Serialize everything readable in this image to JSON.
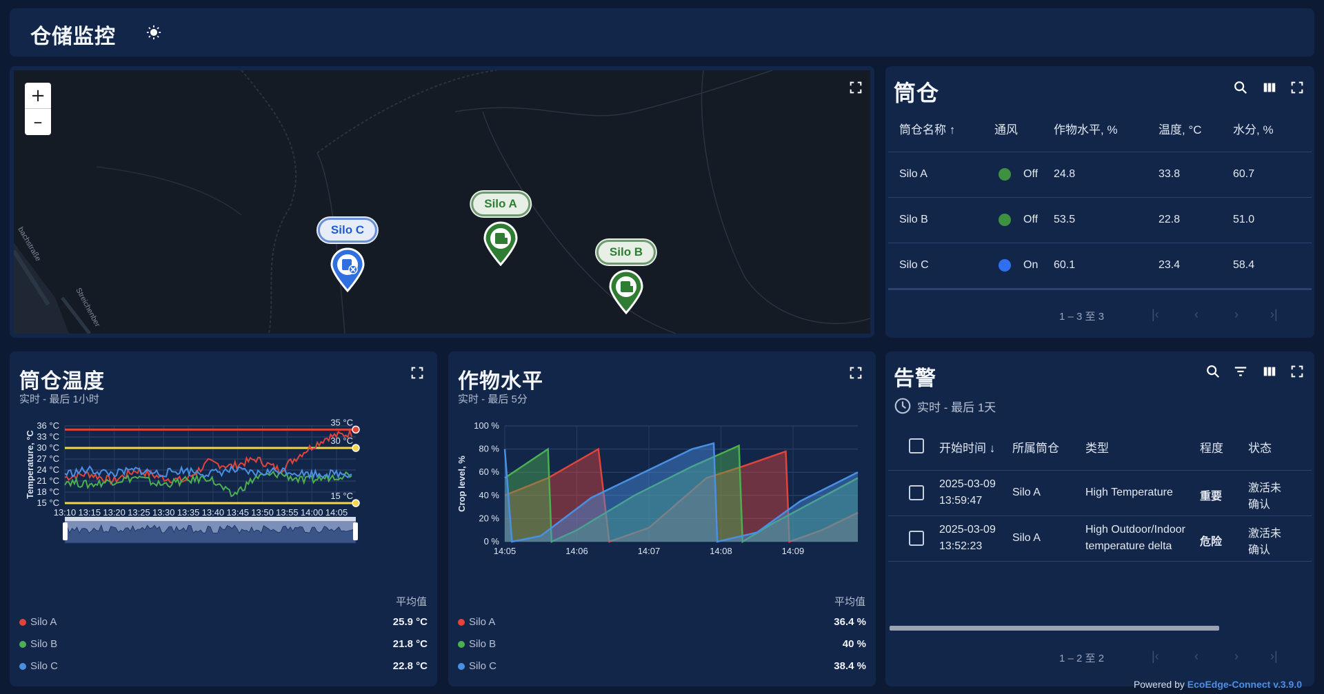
{
  "header": {
    "title": "仓储监控"
  },
  "map": {
    "zoom_in": "+",
    "zoom_out": "–",
    "markers": [
      {
        "label": "Silo C",
        "color": "#2f6fe0"
      },
      {
        "label": "Silo A",
        "color": "#2e7d32"
      },
      {
        "label": "Silo B",
        "color": "#2e7d32"
      }
    ],
    "street1": "bachstraße",
    "street2": "Streichenber"
  },
  "silos": {
    "title": "筒仓",
    "columns": [
      "筒仓名称 ↑",
      "通风",
      "作物水平, %",
      "温度, °C",
      "水分, %"
    ],
    "rows": [
      {
        "name": "Silo A",
        "vent": "Off",
        "vent_color": "#3f9142",
        "crop": "24.8",
        "temp": "33.8",
        "moisture": "60.7"
      },
      {
        "name": "Silo B",
        "vent": "Off",
        "vent_color": "#3f9142",
        "crop": "53.5",
        "temp": "22.8",
        "moisture": "51.0"
      },
      {
        "name": "Silo C",
        "vent": "On",
        "vent_color": "#2f6ff0",
        "crop": "60.1",
        "temp": "23.4",
        "moisture": "58.4"
      }
    ],
    "pagination": "1 – 3 至 3"
  },
  "temp_chart": {
    "title": "筒仓温度",
    "subtitle": "实时 - 最后 1小时",
    "ylabel": "Temperature, °C",
    "avg_label": "平均值",
    "legend": [
      {
        "name": "Silo A",
        "color": "#e0453a",
        "avg": "25.9 °C"
      },
      {
        "name": "Silo B",
        "color": "#4caf50",
        "avg": "21.8 °C"
      },
      {
        "name": "Silo C",
        "color": "#4a90e2",
        "avg": "22.8 °C"
      }
    ],
    "thresholds": [
      {
        "label": "35 °C",
        "value": 35,
        "color": "#e0453a"
      },
      {
        "label": "30 °C",
        "value": 30,
        "color": "#f3d54e"
      },
      {
        "label": "15 °C",
        "value": 15,
        "color": "#f3d54e"
      }
    ]
  },
  "crop_chart": {
    "title": "作物水平",
    "subtitle": "实时 - 最后 5分",
    "ylabel": "Crop level, %",
    "avg_label": "平均值",
    "legend": [
      {
        "name": "Silo A",
        "color": "#e0453a",
        "avg": "36.4 %"
      },
      {
        "name": "Silo B",
        "color": "#4caf50",
        "avg": "40 %"
      },
      {
        "name": "Silo C",
        "color": "#4a90e2",
        "avg": "38.4 %"
      }
    ]
  },
  "alarms": {
    "title": "告警",
    "time_label": "实时 - 最后 1天",
    "columns": [
      "开始时间 ↓",
      "所属筒仓",
      "类型",
      "程度",
      "状态"
    ],
    "rows": [
      {
        "time1": "2025-03-09",
        "time2": "13:59:47",
        "silo": "Silo A",
        "type1": "High Temperature",
        "type2": "",
        "severity": "重要",
        "status1": "激活未",
        "status2": "确认"
      },
      {
        "time1": "2025-03-09",
        "time2": "13:52:23",
        "silo": "Silo A",
        "type1": "High Outdoor/Indoor",
        "type2": "temperature delta",
        "severity": "危险",
        "status1": "激活未",
        "status2": "确认"
      }
    ],
    "pagination": "1 – 2 至 2"
  },
  "footer": {
    "powered": "Powered by",
    "brand": "EcoEdge-Connect v.3.9.0"
  },
  "chart_data": [
    {
      "type": "line",
      "title": "筒仓温度",
      "ylabel": "Temperature, °C",
      "x": [
        "13:10",
        "13:15",
        "13:20",
        "13:25",
        "13:30",
        "13:35",
        "13:40",
        "13:45",
        "13:50",
        "13:55",
        "14:00",
        "14:05"
      ],
      "yticks": [
        "15 °C",
        "18 °C",
        "21 °C",
        "24 °C",
        "27 °C",
        "30 °C",
        "33 °C",
        "36 °C"
      ],
      "ylim": [
        15,
        36
      ],
      "series": [
        {
          "name": "Silo A",
          "color": "#e0453a",
          "values": [
            22,
            23,
            21,
            24,
            22,
            21,
            26,
            25,
            27,
            24,
            29,
            33,
            34
          ]
        },
        {
          "name": "Silo B",
          "color": "#4caf50",
          "values": [
            21,
            20,
            21,
            22,
            20,
            21,
            22,
            17,
            22,
            23,
            21,
            22,
            23
          ]
        },
        {
          "name": "Silo C",
          "color": "#4a90e2",
          "values": [
            23,
            24,
            23,
            24,
            23,
            24,
            23,
            24,
            23,
            24,
            23,
            23,
            23
          ]
        }
      ]
    },
    {
      "type": "area",
      "title": "作物水平",
      "ylabel": "Crop level, %",
      "x": [
        "14:05",
        "14:06",
        "14:07",
        "14:08",
        "14:09"
      ],
      "yticks": [
        "0 %",
        "20 %",
        "40 %",
        "60 %",
        "80 %",
        "100 %"
      ],
      "ylim": [
        0,
        100
      ],
      "series": [
        {
          "name": "Silo A",
          "color": "#e0453a",
          "points": [
            [
              0,
              40
            ],
            [
              0.6,
              55
            ],
            [
              1.3,
              80
            ],
            [
              1.45,
              0
            ],
            [
              2.0,
              12
            ],
            [
              2.8,
              55
            ],
            [
              3.3,
              65
            ],
            [
              3.9,
              78
            ],
            [
              3.95,
              0
            ],
            [
              4.4,
              10
            ],
            [
              4.9,
              25
            ]
          ]
        },
        {
          "name": "Silo B",
          "color": "#4caf50",
          "points": [
            [
              0,
              55
            ],
            [
              0.6,
              80
            ],
            [
              0.65,
              0
            ],
            [
              1.0,
              10
            ],
            [
              1.8,
              40
            ],
            [
              2.6,
              65
            ],
            [
              3.25,
              83
            ],
            [
              3.3,
              0
            ],
            [
              3.7,
              15
            ],
            [
              4.9,
              55
            ]
          ]
        },
        {
          "name": "Silo C",
          "color": "#4a90e2",
          "points": [
            [
              0,
              80
            ],
            [
              0.1,
              0
            ],
            [
              0.5,
              5
            ],
            [
              1.2,
              38
            ],
            [
              1.6,
              50
            ],
            [
              2.6,
              80
            ],
            [
              2.9,
              85
            ],
            [
              2.95,
              0
            ],
            [
              3.5,
              8
            ],
            [
              4.1,
              35
            ],
            [
              4.9,
              60
            ]
          ]
        }
      ]
    }
  ]
}
